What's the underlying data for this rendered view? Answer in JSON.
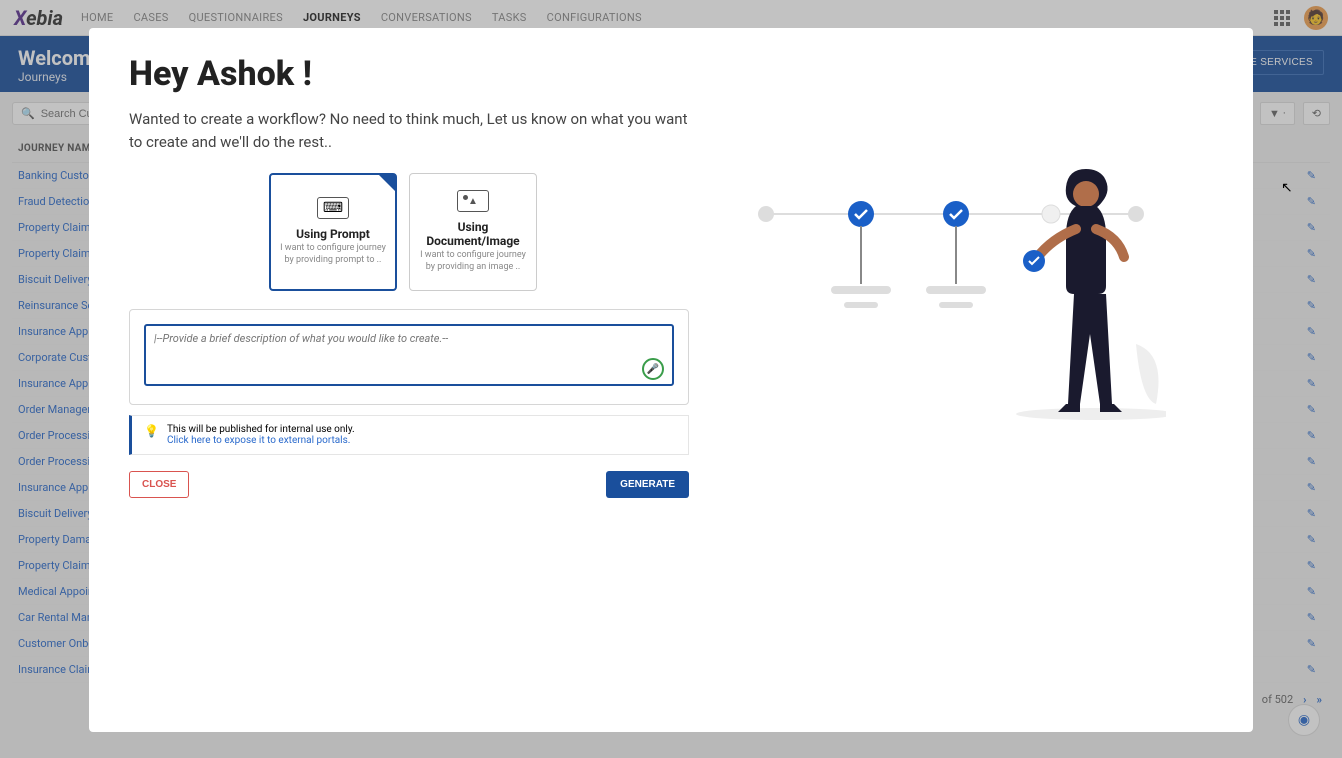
{
  "logo": "Xebia",
  "nav": [
    "HOME",
    "CASES",
    "QUESTIONNAIRES",
    "JOURNEYS",
    "CONVERSATIONS",
    "TASKS",
    "CONFIGURATIONS"
  ],
  "nav_active": 3,
  "banner": {
    "welcome": "Welcome A",
    "crumb": "Journeys",
    "gen_btn": "GENERATE SERVICES"
  },
  "search_placeholder": "Search Custom",
  "table_header": "JOURNEY NAME",
  "journeys": [
    "Banking Custom",
    "Fraud Detection",
    "Property Claim F",
    "Property Claim I",
    "Biscuit Delivery P",
    "Reinsurance Set",
    "Insurance Applic",
    "Corporate Custo",
    "Insurance Applic",
    "Order Managem",
    "Order Processing",
    "Order Processing",
    "Insurance Applic",
    "Biscuit Delivery P",
    "Property Damag",
    "Property Claim F",
    "Medical Appoint",
    "Car Rental Mana",
    "Customer Onboa",
    "Insurance Claim"
  ],
  "pager": {
    "text": "of 502"
  },
  "modal": {
    "title": "Hey Ashok !",
    "subtitle": "Wanted to create a workflow? No need to think much, Let us know on what you want to create and we'll do the rest..",
    "options": [
      {
        "title": "Using Prompt",
        "desc": "I want to configure journey by providing prompt to ..",
        "icon": "kb",
        "selected": true
      },
      {
        "title": "Using Document/Image",
        "desc": "I want to configure journey by providing an image ..",
        "icon": "img",
        "selected": false
      }
    ],
    "placeholder": "|--Provide a brief description of what you would like to create.--",
    "notice_text": "This will be published for internal use only.",
    "notice_link": "Click here to expose it to external portals.",
    "close": "CLOSE",
    "generate": "GENERATE"
  }
}
